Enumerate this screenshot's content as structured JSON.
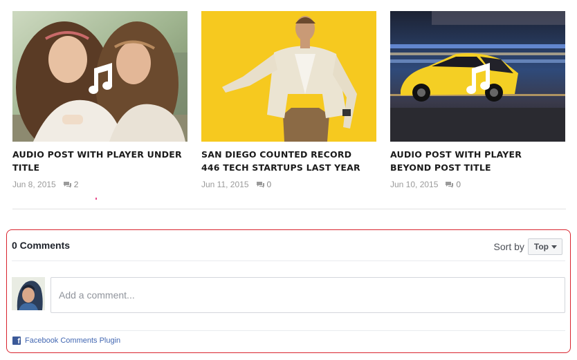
{
  "posts": [
    {
      "title": "Audio Post With Player Under Title",
      "date": "Jun 8, 2015",
      "comments": "2",
      "thumb_icon": "music-note-icon"
    },
    {
      "title": "San Diego Counted Record 446 Tech Startups Last Year",
      "date": "Jun 11, 2015",
      "comments": "0",
      "thumb_icon": ""
    },
    {
      "title": "Audio Post With Player Beyond Post Title",
      "date": "Jun 10, 2015",
      "comments": "0",
      "thumb_icon": "music-note-icon"
    }
  ],
  "comments_plugin": {
    "count_label": "0 Comments",
    "sort_label": "Sort by",
    "sort_value": "Top",
    "input_placeholder": "Add a comment...",
    "footer_label": "Facebook Comments Plugin",
    "brand_color": "#3b5998",
    "frame_color": "#d9232d"
  }
}
